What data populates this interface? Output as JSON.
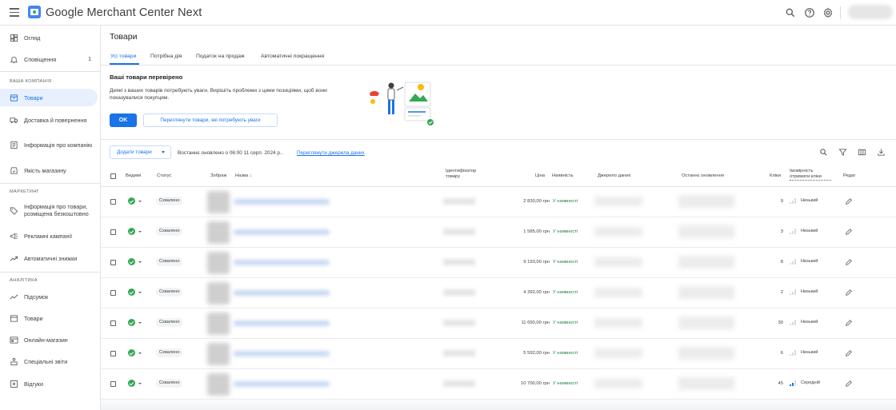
{
  "app": {
    "title": "Google Merchant Center Next"
  },
  "sidebar": {
    "items_top": [
      {
        "label": "Огляд",
        "icon": "dashboard-icon"
      },
      {
        "label": "Сповіщення",
        "icon": "bell-icon",
        "count": "1"
      }
    ],
    "section_company": "ВАША КОМПАНІЯ",
    "items_company": [
      {
        "label": "Товари",
        "icon": "products-icon"
      },
      {
        "label": "Доставка й повернення",
        "icon": "truck-icon"
      },
      {
        "label": "Інформація про компанію",
        "icon": "store-icon"
      },
      {
        "label": "Якість магазину",
        "icon": "quality-icon"
      }
    ],
    "section_marketing": "МАРКЕТИНГ",
    "items_marketing": [
      {
        "label": "Інформація про товари, розміщена безкоштовно",
        "icon": "tag-icon"
      },
      {
        "label": "Рекламні кампанії",
        "icon": "megaphone-icon"
      },
      {
        "label": "Автоматичні знижки",
        "icon": "trend-icon"
      }
    ],
    "section_analytics": "АНАЛІТИКА",
    "items_analytics": [
      {
        "label": "Підсумок",
        "icon": "chart-icon"
      },
      {
        "label": "Товари",
        "icon": "products-report-icon"
      },
      {
        "label": "Онлайн-магазин",
        "icon": "storefront-icon"
      },
      {
        "label": "Спеціальні звіти",
        "icon": "custom-reports-icon"
      },
      {
        "label": "Відгуки",
        "icon": "reviews-icon"
      }
    ]
  },
  "main": {
    "title": "Товари",
    "tabs": [
      {
        "label": "Усі товари"
      },
      {
        "label": "Потрібна дія"
      },
      {
        "label": "Податок на продаж"
      },
      {
        "label": "Автоматичні покращення"
      }
    ],
    "banner": {
      "title": "Ваші товари перевірено",
      "text": "Деякі з ваших товарів потребують уваги. Вирішіть проблеми з цими позиціями, щоб вони показувалися покупцям.",
      "ok_label": "OK",
      "review_label": "Переглянути товари, які потребують уваги"
    },
    "toolbar": {
      "add_label": "Додати товари",
      "updated_text": "Востаннє оновлено о 06:00 11 серп. 2024 р..",
      "sources_link": "Переглянути джерела даних"
    },
    "table": {
      "headers": {
        "visibility": "Видимі",
        "status": "Статус",
        "image": "Зображ",
        "name": "Назва",
        "id": "Ідентифікатор товару",
        "price": "Ціна",
        "availability": "Наявність",
        "source": "Джерело даних",
        "updated": "Останнє оновлення",
        "clicks": "Кліки",
        "probability": "Імовірність отримати кліки",
        "edit": "Редаг"
      },
      "rows": [
        {
          "status": "Схвалено",
          "price": "2 830,00 грн",
          "availability": "У наявності",
          "clicks": "9",
          "probability": "Низький",
          "level": 1
        },
        {
          "status": "Схвалено",
          "price": "1 585,00 грн",
          "availability": "У наявності",
          "clicks": "3",
          "probability": "Низький",
          "level": 1
        },
        {
          "status": "Схвалено",
          "price": "9 150,00 грн",
          "availability": "У наявності",
          "clicks": "8",
          "probability": "Низький",
          "level": 1
        },
        {
          "status": "Схвалено",
          "price": "4 392,00 грн",
          "availability": "У наявності",
          "clicks": "2",
          "probability": "Низький",
          "level": 1
        },
        {
          "status": "Схвалено",
          "price": "11 650,00 грн",
          "availability": "У наявності",
          "clicks": "30",
          "probability": "Низький",
          "level": 1
        },
        {
          "status": "Схвалено",
          "price": "5 592,00 грн",
          "availability": "У наявності",
          "clicks": "6",
          "probability": "Низький",
          "level": 1
        },
        {
          "status": "Схвалено",
          "price": "10 700,00 грн",
          "availability": "У наявності",
          "clicks": "45",
          "probability": "Середній",
          "level": 2
        }
      ]
    }
  },
  "colors": {
    "accent": "#1a73e8",
    "success": "#34a853",
    "available_text": "#188038",
    "active_bg": "#e8f0fe"
  }
}
